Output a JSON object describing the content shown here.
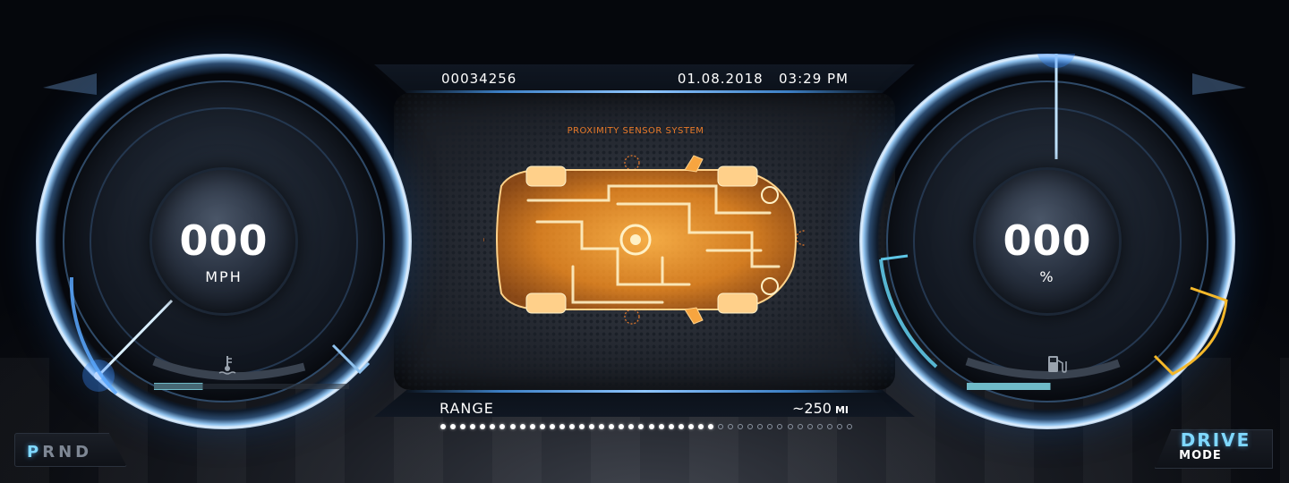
{
  "speedometer": {
    "value": "000",
    "unit": "MPH",
    "temp_icon": "engine-coolant-temperature-icon",
    "temp_level": 0.25
  },
  "battery_gauge": {
    "value": "000",
    "unit": "%",
    "fuel_icon": "fuel-pump-icon",
    "level": 0.55
  },
  "header": {
    "odometer": "00034256",
    "date": "01.08.2018",
    "time": "03:29 PM"
  },
  "proximity": {
    "title": "PROXIMITY SENSOR SYSTEM",
    "car_icon": "car-xray-icon"
  },
  "range": {
    "label": "RANGE",
    "value": "~250",
    "unit": "MI",
    "filled_dots": 28,
    "total_dots": 42
  },
  "gear": {
    "letters": [
      "P",
      "R",
      "N",
      "D"
    ],
    "active": "P"
  },
  "drive_mode": {
    "line1": "DRIVE",
    "line2": "MODE"
  },
  "colors": {
    "accent_blue": "#7fd8ff",
    "sensor_orange": "#e97a29",
    "warning_yellow": "#f5b82a",
    "ring_blue": "#8fc2ee"
  }
}
